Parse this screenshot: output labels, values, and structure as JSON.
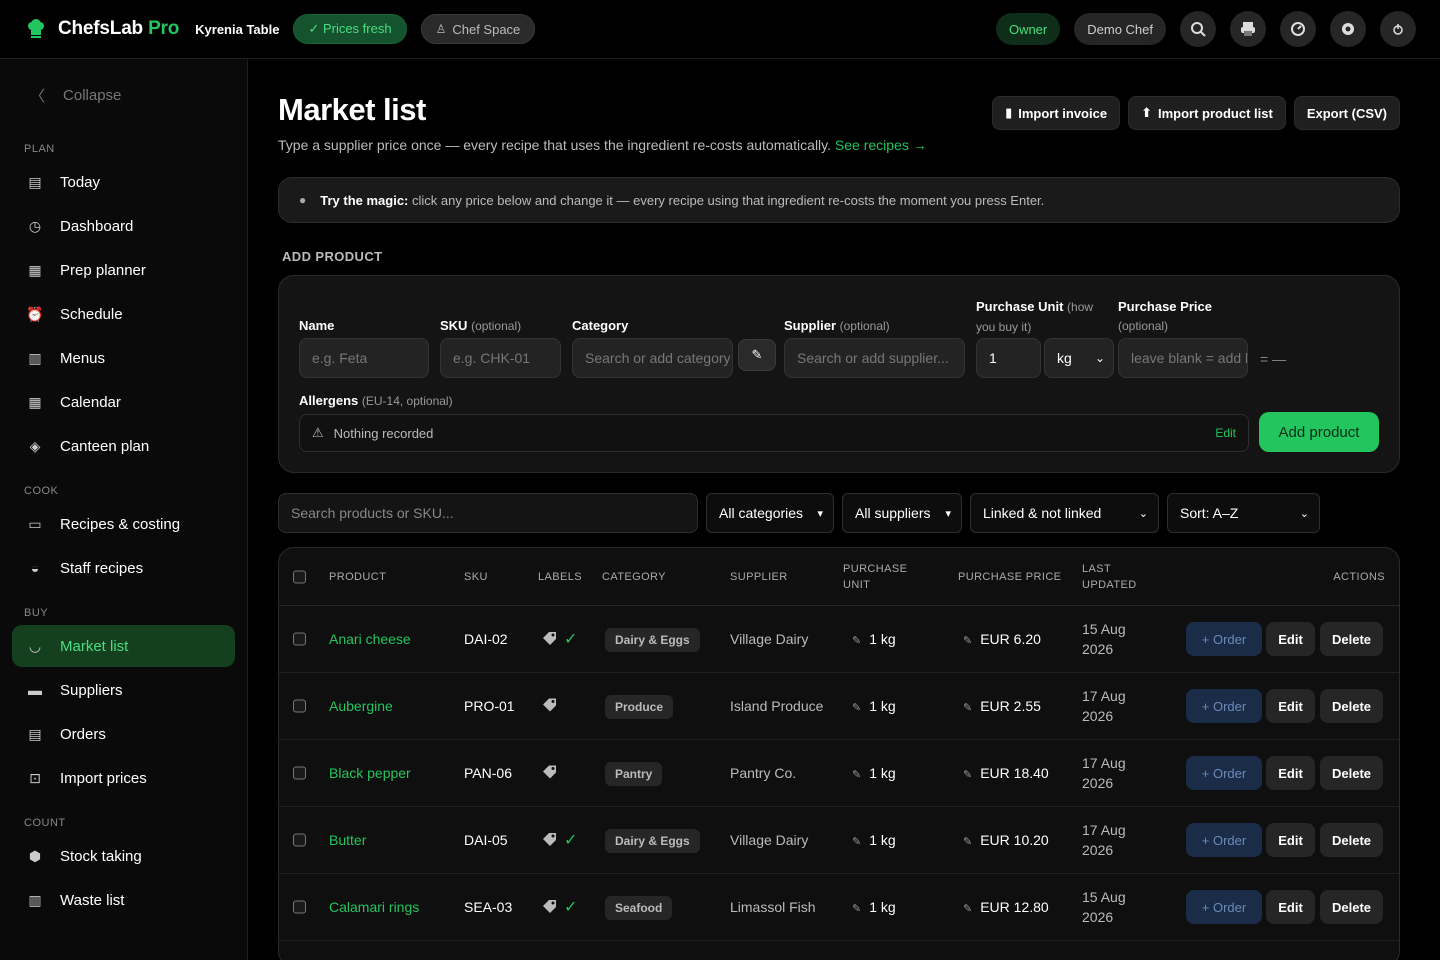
{
  "app": {
    "brand_main": "ChefsLab",
    "brand_pro": "Pro",
    "venue": "Kyrenia Table",
    "prices_pill": "✓ Prices fresh",
    "chef_space": "Chef Space",
    "owner": "Owner",
    "demo_chef": "Demo Chef",
    "accent": "#22c55e"
  },
  "sidebar": {
    "collapse": "Collapse",
    "sections": {
      "plan": "PLAN",
      "cook": "COOK",
      "buy": "BUY",
      "count": "COUNT"
    },
    "items": {
      "today": "Today",
      "dashboard": "Dashboard",
      "prep": "Prep planner",
      "schedule": "Schedule",
      "menus": "Menus",
      "calendar": "Calendar",
      "canteen": "Canteen plan",
      "recipes": "Recipes & costing",
      "staff": "Staff recipes",
      "market": "Market list",
      "suppliers": "Suppliers",
      "orders": "Orders",
      "import": "Import prices",
      "stock": "Stock taking",
      "waste": "Waste list"
    }
  },
  "page": {
    "title": "Market list",
    "subtitle": "Type a supplier price once — every recipe that uses the ingredient re-costs automatically. ",
    "subtitle_link": "See recipes →",
    "import_invoice": "Import invoice",
    "import_products": "Import product list",
    "export": "Export (CSV)"
  },
  "magic": {
    "bold": "Try the magic:",
    "text": " click any price below and change it — every recipe using that ingredient re-costs the moment you press Enter."
  },
  "add": {
    "section": "ADD PRODUCT",
    "name_label": "Name",
    "name_ph": "e.g. Feta",
    "sku_label": "SKU",
    "sku_opt": "(optional)",
    "sku_ph": "e.g. CHK-01",
    "cat_label": "Category",
    "cat_ph": "Search or add category",
    "sup_label": "Supplier",
    "sup_opt": "(optional)",
    "sup_ph": "Search or add supplier...",
    "unit_label": "Purchase Unit",
    "unit_opt": "(how you buy it)",
    "unit_qty": "1",
    "unit_sel": "kg",
    "price_label": "Purchase Price",
    "price_opt": "(optional)",
    "price_ph": "leave blank = add later",
    "eq": "= —",
    "allergens_label": "Allergens",
    "allergens_opt": "(EU-14, optional)",
    "allergens_value": "Nothing recorded",
    "allergens_edit": "Edit",
    "add_btn": "Add product"
  },
  "filters": {
    "search_ph": "Search products or SKU...",
    "categories": "All categories",
    "suppliers": "All suppliers",
    "linked": "Linked & not linked",
    "sort": "Sort: A–Z"
  },
  "table": {
    "headers": {
      "product": "PRODUCT",
      "sku": "SKU",
      "labels": "LABELS",
      "category": "CATEGORY",
      "supplier": "SUPPLIER",
      "unit_1": "PURCHASE",
      "unit_2": "UNIT",
      "price": "PURCHASE PRICE",
      "updated_1": "LAST",
      "updated_2": "UPDATED",
      "actions": "ACTIONS"
    },
    "order_label": "+ Order",
    "edit_label": "Edit",
    "delete_label": "Delete",
    "rows": [
      {
        "product": "Anari cheese",
        "sku": "DAI-02",
        "checked": "✓",
        "category": "Dairy & Eggs",
        "supplier": "Village Dairy",
        "unit": "1 kg",
        "price": "EUR 6.20",
        "updated_1": "15 Aug",
        "updated_2": "2026"
      },
      {
        "product": "Aubergine",
        "sku": "PRO-01",
        "checked": "",
        "category": "Produce",
        "supplier": "Island Produce",
        "unit": "1 kg",
        "price": "EUR 2.55",
        "updated_1": "17 Aug",
        "updated_2": "2026"
      },
      {
        "product": "Black pepper",
        "sku": "PAN-06",
        "checked": "",
        "category": "Pantry",
        "supplier": "Pantry Co.",
        "unit": "1 kg",
        "price": "EUR 18.40",
        "updated_1": "17 Aug",
        "updated_2": "2026"
      },
      {
        "product": "Butter",
        "sku": "DAI-05",
        "checked": "✓",
        "category": "Dairy & Eggs",
        "supplier": "Village Dairy",
        "unit": "1 kg",
        "price": "EUR 10.20",
        "updated_1": "17 Aug",
        "updated_2": "2026"
      },
      {
        "product": "Calamari rings",
        "sku": "SEA-03",
        "checked": "✓",
        "category": "Seafood",
        "supplier": "Limassol Fish",
        "unit": "1 kg",
        "price": "EUR 12.80",
        "updated_1": "15 Aug",
        "updated_2": "2026"
      }
    ]
  }
}
